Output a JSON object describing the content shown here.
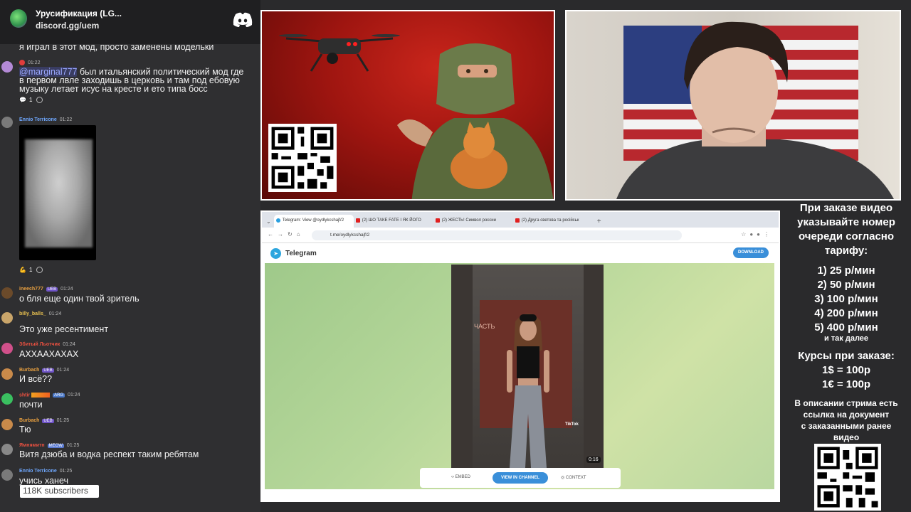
{
  "discord": {
    "title": "Урусификация (LG...",
    "link": "discord.gg/uem"
  },
  "chat": {
    "messages": [
      {
        "nick": "",
        "time": "",
        "text": "я играл в этот мод, просто заменены модельки"
      },
      {
        "nick": "",
        "time": "01:22",
        "mention": "@marginal777",
        "text": " был итальянский политический мод где",
        "text2": "в первом лвле заходишь в церковь и там под ебовую",
        "text3": "музыку летает исус на кресте и ето типа босс",
        "reaction_count": "1"
      },
      {
        "nick": "Ennio Terricone",
        "time": "01:22",
        "reaction_count": "1"
      },
      {
        "nick": "ineech777",
        "badge": "UEB",
        "time": "01:24",
        "text": "о бля еще один твой зритель"
      },
      {
        "nick": "billy_balls_",
        "time": "01:24",
        "text": "Это уже ресентимент"
      },
      {
        "nick": "Збитый Льотчик",
        "time": "01:24",
        "text": "АХХААХАХАХ"
      },
      {
        "nick": "Burbach",
        "badge": "UEB",
        "time": "01:24",
        "text": "И всё??"
      },
      {
        "nick": "shtir",
        "badge": "ARG",
        "time": "01:24",
        "text": "почти"
      },
      {
        "nick": "Burbach",
        "badge": "UEB",
        "time": "01:25",
        "text": "Тю"
      },
      {
        "nick": "Ямнямитн",
        "badge": "MEOW",
        "time": "01:25",
        "text": "Витя дзюба и водка респект таким ребятам"
      },
      {
        "nick": "Ennio Terricone",
        "time": "01:25",
        "text": "учись ханеч"
      }
    ],
    "subscribers": "118K subscribers"
  },
  "browser": {
    "tabs": [
      {
        "label": "Telegram: View @oydlykcshajf/2"
      },
      {
        "label": "(2) ШО ТАКЕ FATE І ЯК ЙОГО"
      },
      {
        "label": "(2) ЖЕСТЬ! Символ россии"
      },
      {
        "label": "(2) Другa светова та російськ"
      }
    ],
    "url": "t.me/oydlykcshajf/2",
    "site_name": "Telegram",
    "download_label": "DOWNLOAD",
    "sign_text": "ЧАСТЬ",
    "tiktok_label": "TikTok",
    "duration": "0:16",
    "embed_label": "EMBED",
    "view_label": "VIEW IN CHANNEL",
    "context_label": "CONTEXT"
  },
  "info": {
    "heading": [
      "При заказе видео",
      "указывайте номер",
      "очереди согласно",
      "тарифу:"
    ],
    "tariffs": [
      "1) 25 р/мин",
      "2) 50 р/мин",
      "3) 100 р/мин",
      "4) 200 р/мин",
      "5) 400 р/мин"
    ],
    "etc": "и так далее",
    "rates_title": "Курсы при заказе:",
    "rates": [
      "1$ = 100р",
      "1€ = 100р"
    ],
    "note": [
      "В описании стрима есть",
      "ссылка на документ",
      "с заказанными ранее",
      "видео"
    ]
  },
  "colors": {
    "discord_blurple": "#5865F2",
    "telegram_blue": "#2ea6de",
    "button_blue": "#3a8fd9",
    "art_red": "#c9251b"
  }
}
